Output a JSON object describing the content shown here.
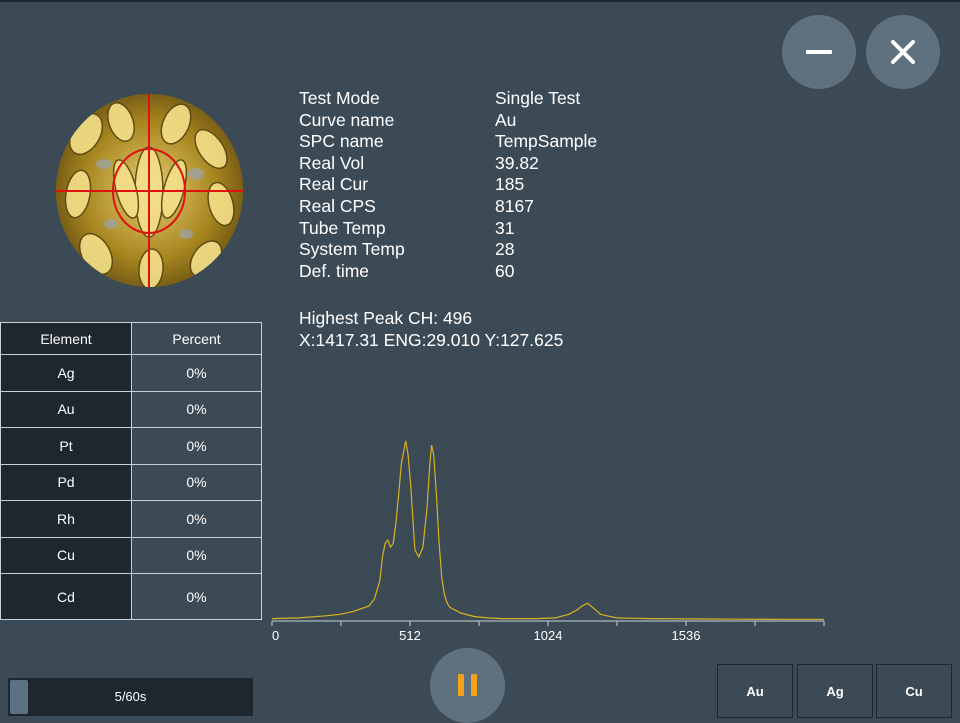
{
  "info_rows": [
    {
      "label": "Test Mode",
      "value": "Single Test"
    },
    {
      "label": "Curve name",
      "value": "Au"
    },
    {
      "label": "SPC name",
      "value": "TempSample"
    },
    {
      "label": "Real Vol",
      "value": "39.82"
    },
    {
      "label": "Real Cur",
      "value": "185"
    },
    {
      "label": "Real CPS",
      "value": "8167"
    },
    {
      "label": "Tube Temp",
      "value": "31"
    },
    {
      "label": "System Temp",
      "value": "28"
    },
    {
      "label": "Def. time",
      "value": "60"
    }
  ],
  "peak": {
    "line1": "Highest Peak CH: 496",
    "line2": "X:1417.31 ENG:29.010 Y:127.625"
  },
  "table": {
    "header_element": "Element",
    "header_percent": "Percent",
    "rows": [
      {
        "element": "Ag",
        "percent": "0%"
      },
      {
        "element": "Au",
        "percent": "0%"
      },
      {
        "element": "Pt",
        "percent": "0%"
      },
      {
        "element": "Pd",
        "percent": "0%"
      },
      {
        "element": "Rh",
        "percent": "0%"
      },
      {
        "element": "Cu",
        "percent": "0%"
      },
      {
        "element": "Cd",
        "percent": "0%"
      }
    ]
  },
  "window_buttons": {
    "minimize_icon": "minus-icon",
    "close_icon": "close-icon"
  },
  "progress": {
    "text": "5/60s",
    "fraction": 0.0833
  },
  "pause_icon": "pause-icon",
  "element_buttons": [
    "Au",
    "Ag",
    "Cu"
  ],
  "colors": {
    "background": "#3c4a55",
    "dark_panel": "#1e272e",
    "spectrum_line": "#d8b223",
    "accent_orange": "#f3a21c",
    "crosshair": "#e01010"
  },
  "chart_data": {
    "type": "line",
    "x_tick_labels": [
      "0",
      "512",
      "1024",
      "1536"
    ],
    "xlim": [
      0,
      2048
    ],
    "ylim": [
      0,
      130
    ],
    "series": [
      {
        "x": [
          0,
          100,
          200,
          250,
          300,
          330,
          360,
          380,
          400,
          410,
          420,
          430,
          440,
          450,
          460,
          470,
          480,
          490,
          496,
          505,
          515,
          530,
          545,
          560,
          575,
          585,
          592,
          600,
          610,
          620,
          630,
          640,
          650,
          660,
          680,
          700,
          750,
          800,
          850,
          900,
          980,
          1050,
          1100,
          1130,
          1150,
          1170,
          1190,
          1220,
          1280,
          1400,
          1550,
          1750,
          1900,
          2048
        ],
        "y": [
          1,
          1.5,
          3,
          4,
          6,
          8,
          10,
          15,
          28,
          45,
          55,
          57,
          52,
          55,
          70,
          90,
          112,
          122,
          128,
          118,
          95,
          50,
          45,
          52,
          80,
          110,
          125,
          118,
          90,
          55,
          30,
          18,
          12,
          9,
          7,
          5,
          2.5,
          1.5,
          1,
          1,
          1,
          1.5,
          4,
          7,
          10,
          12,
          9,
          4,
          1.5,
          1,
          0.8,
          0.6,
          0.5,
          0.5
        ]
      }
    ]
  }
}
